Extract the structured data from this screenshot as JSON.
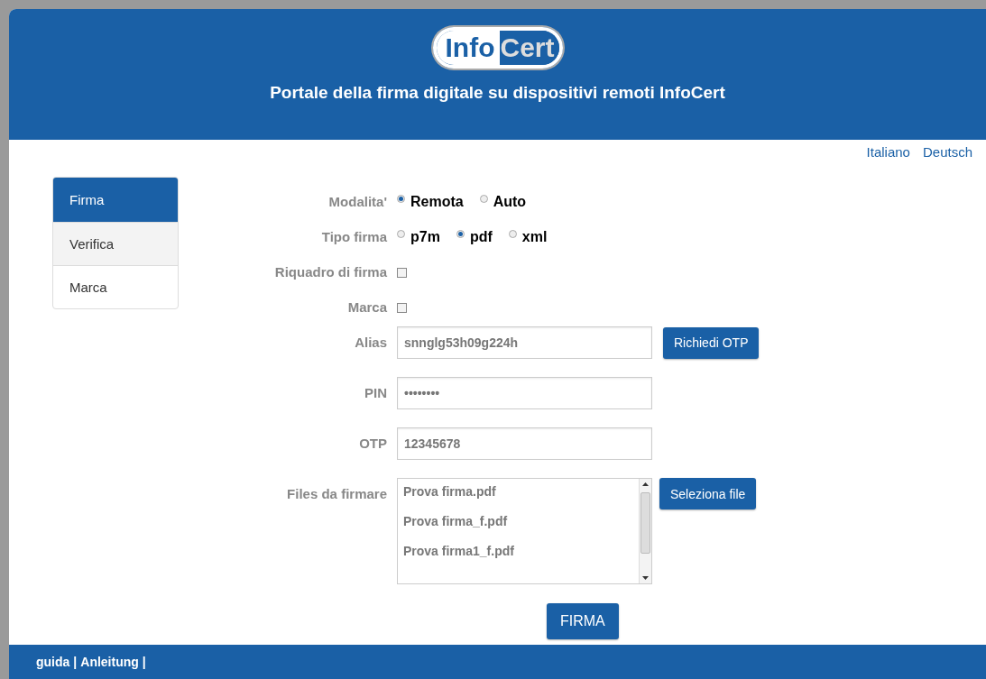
{
  "header": {
    "logo_parts": [
      "Info",
      "Cert"
    ],
    "title": "Portale della firma digitale su dispositivi remoti InfoCert"
  },
  "languages": [
    "Italiano",
    "Deutsch"
  ],
  "sidebar": {
    "items": [
      {
        "label": "Firma",
        "selected": true
      },
      {
        "label": "Verifica",
        "selected": false
      },
      {
        "label": "Marca",
        "selected": false
      }
    ]
  },
  "form": {
    "rows": [
      {
        "kind": "radio",
        "label": "Modalita'",
        "options": [
          {
            "label": "Remota",
            "selected": true
          },
          {
            "label": "Auto",
            "selected": false
          }
        ]
      },
      {
        "kind": "radio",
        "label": "Tipo firma",
        "options": [
          {
            "label": "p7m",
            "selected": false
          },
          {
            "label": "pdf",
            "selected": true
          },
          {
            "label": "xml",
            "selected": false
          }
        ]
      },
      {
        "kind": "checkbox",
        "label": "Riquadro di firma",
        "checked": false
      },
      {
        "kind": "checkbox",
        "label": "Marca",
        "checked": false
      },
      {
        "kind": "text",
        "label": "Alias",
        "value": "snnglg53h09g224h",
        "button": "Richiedi OTP"
      },
      {
        "kind": "text",
        "label": "PIN",
        "value": "••••••••"
      },
      {
        "kind": "text",
        "label": "OTP",
        "value": "12345678"
      },
      {
        "kind": "files",
        "label": "Files da firmare",
        "files": [
          "Prova firma.pdf",
          "Prova firma_f.pdf",
          "Prova firma1_f.pdf"
        ],
        "button": "Seleziona file"
      }
    ],
    "submit": "FIRMA"
  },
  "footer": {
    "links": [
      "guida",
      "Anleitung"
    ],
    "separator": "|"
  }
}
